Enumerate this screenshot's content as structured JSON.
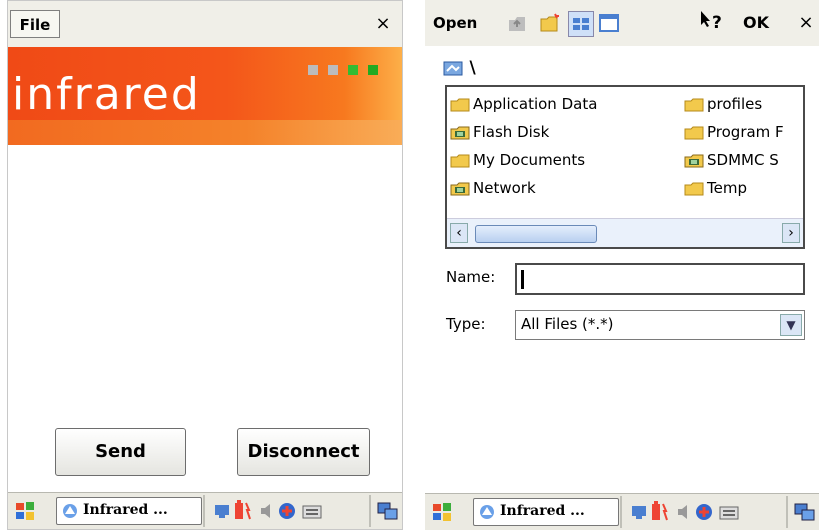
{
  "left": {
    "menu": {
      "file_label": "File",
      "close_label": "×"
    },
    "banner": {
      "title": "infrared",
      "squares": [
        "#bcbcbc",
        "#bcbcbc",
        "#33bb33",
        "#22aa22"
      ]
    },
    "buttons": {
      "send_label": "Send",
      "disconnect_label": "Disconnect"
    },
    "taskbar": {
      "task_label": "Infrared ..."
    }
  },
  "right": {
    "toolbar": {
      "open_label": "Open",
      "help_label": "?",
      "ok_label": "OK",
      "close_label": "×"
    },
    "path": "\\",
    "files_left": [
      {
        "name": "Application Data",
        "icon": "folder-icon"
      },
      {
        "name": "Flash Disk",
        "icon": "storage-card-icon"
      },
      {
        "name": "My Documents",
        "icon": "folder-icon"
      },
      {
        "name": "Network",
        "icon": "storage-card-icon"
      }
    ],
    "files_right": [
      {
        "name": "profiles",
        "icon": "folder-icon"
      },
      {
        "name": "Program F",
        "icon": "folder-icon"
      },
      {
        "name": "SDMMC S",
        "icon": "storage-card-icon"
      },
      {
        "name": "Temp",
        "icon": "folder-icon"
      }
    ],
    "name_label": "Name:",
    "name_value": "",
    "type_label": "Type:",
    "type_value": "All Files (*.*)",
    "taskbar": {
      "task_label": "Infrared ..."
    }
  },
  "colors": {
    "accent_orange": "#f04a16",
    "menubar": "#f0efe8",
    "taskbar": "#ebeae2",
    "folder": "#f2c94c"
  }
}
